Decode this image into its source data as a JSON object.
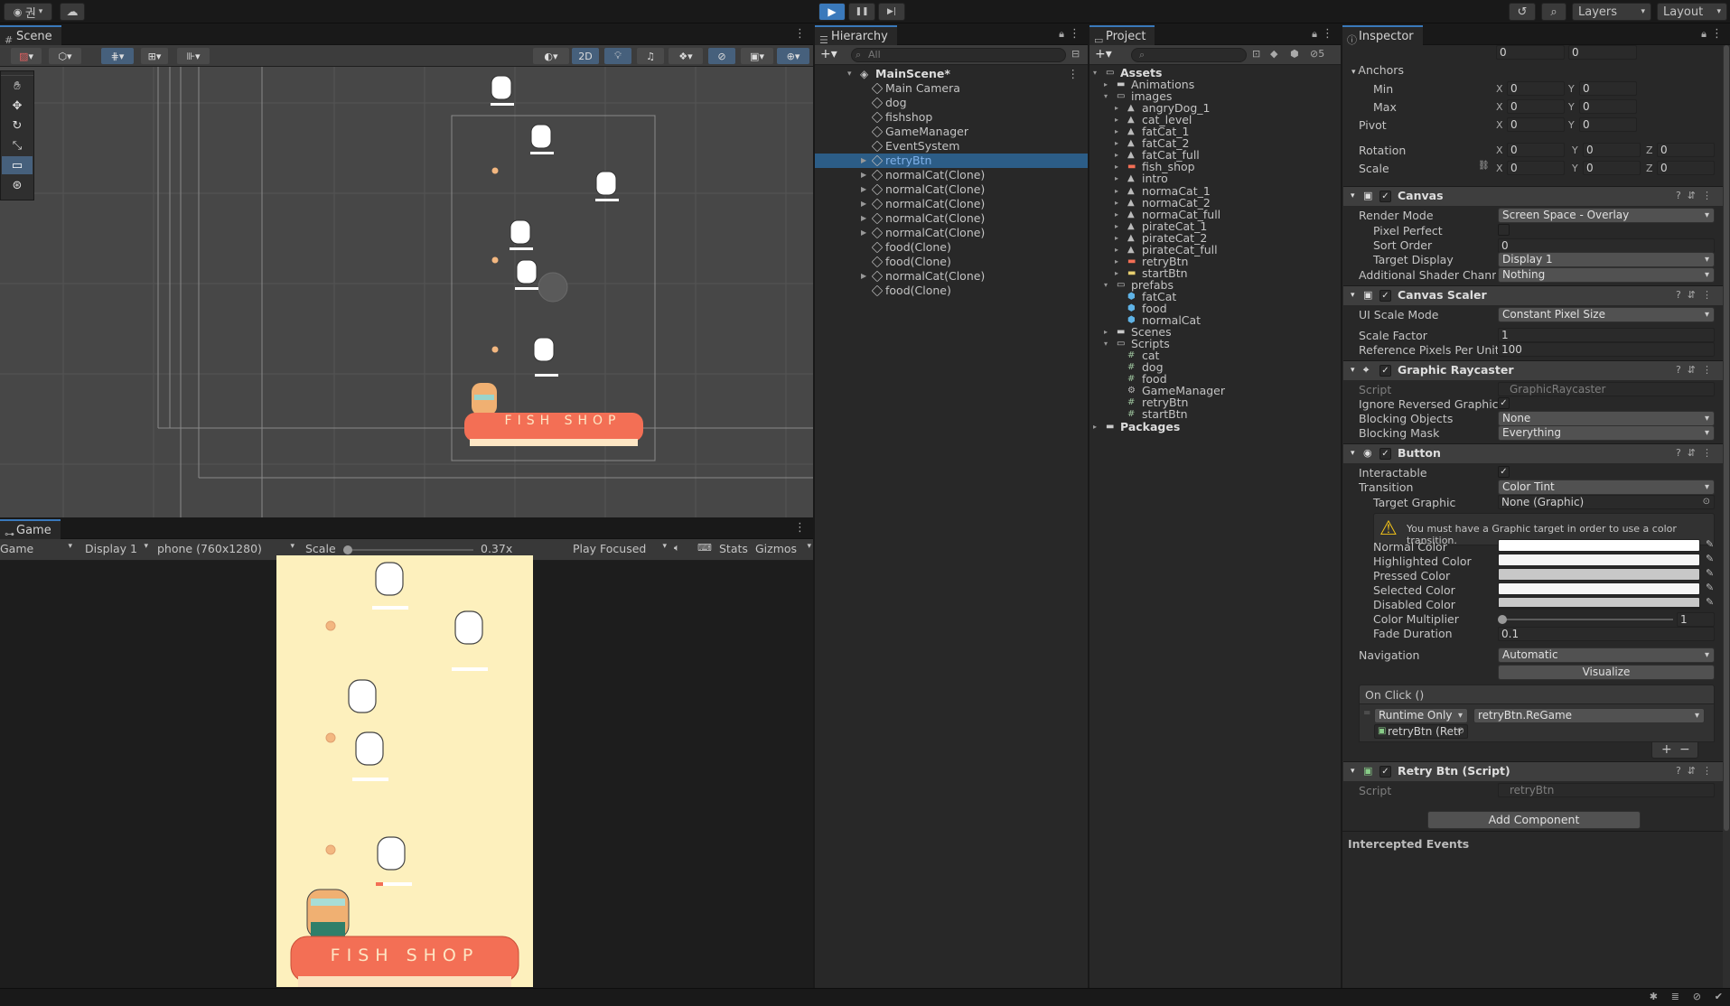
{
  "topbar": {
    "account": "권",
    "play": "▶",
    "pause": "❚❚",
    "step": "▶|",
    "layers": "Layers",
    "layout": "Layout"
  },
  "scene": {
    "tab": "Scene",
    "mode2d": "2D"
  },
  "game": {
    "tab": "Game",
    "view": "Game",
    "display": "Display 1",
    "resolution": "phone (760x1280)",
    "scale_label": "Scale",
    "scale_value": "0.37x",
    "play_mode": "Play Focused",
    "stats": "Stats",
    "gizmos": "Gizmos",
    "shop_text": "FISH  SHOP",
    "scene_shop_text": "FISH  SHOP"
  },
  "hierarchy": {
    "tab": "Hierarchy",
    "search_placeholder": "All",
    "scene": "MainScene*",
    "items": [
      {
        "label": "Main Camera",
        "arrow": false,
        "selected": false
      },
      {
        "label": "dog",
        "arrow": false,
        "selected": false
      },
      {
        "label": "fishshop",
        "arrow": false,
        "selected": false
      },
      {
        "label": "GameManager",
        "arrow": false,
        "selected": false
      },
      {
        "label": "EventSystem",
        "arrow": false,
        "selected": false
      },
      {
        "label": "retryBtn",
        "arrow": true,
        "selected": true
      },
      {
        "label": "normalCat(Clone)",
        "arrow": true,
        "selected": false
      },
      {
        "label": "normalCat(Clone)",
        "arrow": true,
        "selected": false
      },
      {
        "label": "normalCat(Clone)",
        "arrow": true,
        "selected": false
      },
      {
        "label": "normalCat(Clone)",
        "arrow": true,
        "selected": false
      },
      {
        "label": "normalCat(Clone)",
        "arrow": true,
        "selected": false
      },
      {
        "label": "food(Clone)",
        "arrow": false,
        "selected": false
      },
      {
        "label": "food(Clone)",
        "arrow": false,
        "selected": false
      },
      {
        "label": "normalCat(Clone)",
        "arrow": true,
        "selected": false
      },
      {
        "label": "food(Clone)",
        "arrow": false,
        "selected": false
      }
    ]
  },
  "project": {
    "tab": "Project",
    "hidden_count": "5",
    "tree": [
      {
        "label": "Assets",
        "indent": 0,
        "type": "folder-open",
        "arrow": "▾"
      },
      {
        "label": "Animations",
        "indent": 1,
        "type": "folder",
        "arrow": "▸"
      },
      {
        "label": "images",
        "indent": 1,
        "type": "folder-open",
        "arrow": "▾"
      },
      {
        "label": "angryDog_1",
        "indent": 2,
        "type": "sprite",
        "arrow": "▸"
      },
      {
        "label": "cat_level",
        "indent": 2,
        "type": "sprite",
        "arrow": "▸"
      },
      {
        "label": "fatCat_1",
        "indent": 2,
        "type": "sprite",
        "arrow": "▸"
      },
      {
        "label": "fatCat_2",
        "indent": 2,
        "type": "sprite",
        "arrow": "▸"
      },
      {
        "label": "fatCat_full",
        "indent": 2,
        "type": "sprite",
        "arrow": "▸"
      },
      {
        "label": "fish_shop",
        "indent": 2,
        "type": "sprite-red",
        "arrow": "▸"
      },
      {
        "label": "intro",
        "indent": 2,
        "type": "sprite",
        "arrow": "▸"
      },
      {
        "label": "normaCat_1",
        "indent": 2,
        "type": "sprite",
        "arrow": "▸"
      },
      {
        "label": "normaCat_2",
        "indent": 2,
        "type": "sprite",
        "arrow": "▸"
      },
      {
        "label": "normaCat_full",
        "indent": 2,
        "type": "sprite",
        "arrow": "▸"
      },
      {
        "label": "pirateCat_1",
        "indent": 2,
        "type": "sprite",
        "arrow": "▸"
      },
      {
        "label": "pirateCat_2",
        "indent": 2,
        "type": "sprite",
        "arrow": "▸"
      },
      {
        "label": "pirateCat_full",
        "indent": 2,
        "type": "sprite",
        "arrow": "▸"
      },
      {
        "label": "retryBtn",
        "indent": 2,
        "type": "sprite-red",
        "arrow": "▸"
      },
      {
        "label": "startBtn",
        "indent": 2,
        "type": "sprite-yellow",
        "arrow": "▸"
      },
      {
        "label": "prefabs",
        "indent": 1,
        "type": "folder-open",
        "arrow": "▾"
      },
      {
        "label": "fatCat",
        "indent": 2,
        "type": "prefab",
        "arrow": ""
      },
      {
        "label": "food",
        "indent": 2,
        "type": "prefab",
        "arrow": ""
      },
      {
        "label": "normalCat",
        "indent": 2,
        "type": "prefab",
        "arrow": ""
      },
      {
        "label": "Scenes",
        "indent": 1,
        "type": "folder",
        "arrow": "▸"
      },
      {
        "label": "Scripts",
        "indent": 1,
        "type": "folder-open",
        "arrow": "▾"
      },
      {
        "label": "cat",
        "indent": 2,
        "type": "script",
        "arrow": ""
      },
      {
        "label": "dog",
        "indent": 2,
        "type": "script",
        "arrow": ""
      },
      {
        "label": "food",
        "indent": 2,
        "type": "script",
        "arrow": ""
      },
      {
        "label": "GameManager",
        "indent": 2,
        "type": "gear",
        "arrow": ""
      },
      {
        "label": "retryBtn",
        "indent": 2,
        "type": "script",
        "arrow": ""
      },
      {
        "label": "startBtn",
        "indent": 2,
        "type": "script",
        "arrow": ""
      },
      {
        "label": "Packages",
        "indent": 0,
        "type": "folder",
        "arrow": "▸"
      }
    ]
  },
  "inspector": {
    "tab": "Inspector",
    "top_values": [
      "0",
      "0"
    ],
    "anchors": "Anchors",
    "min": "Min",
    "max": "Max",
    "pivot": "Pivot",
    "rotation": "Rotation",
    "scale": "Scale",
    "anchor_min": [
      "0",
      "0"
    ],
    "anchor_max": [
      "0",
      "0"
    ],
    "pivot_vals": [
      "0",
      "0"
    ],
    "rotation_vals": [
      "0",
      "0",
      "0"
    ],
    "scale_vals": [
      "0",
      "0",
      "0"
    ],
    "canvas": {
      "title": "Canvas",
      "render_mode_label": "Render Mode",
      "render_mode": "Screen Space - Overlay",
      "pixel_perfect": "Pixel Perfect",
      "sort_order_label": "Sort Order",
      "sort_order": "0",
      "target_display_label": "Target Display",
      "target_display": "Display 1",
      "shader_label": "Additional Shader Channels",
      "shader": "Nothing"
    },
    "scaler": {
      "title": "Canvas Scaler",
      "ui_scale_label": "UI Scale Mode",
      "ui_scale": "Constant Pixel Size",
      "scale_factor_label": "Scale Factor",
      "scale_factor": "1",
      "ref_ppu_label": "Reference Pixels Per Unit",
      "ref_ppu": "100"
    },
    "raycaster": {
      "title": "Graphic Raycaster",
      "script_label": "Script",
      "script": "GraphicRaycaster",
      "ignore_label": "Ignore Reversed Graphics",
      "blocking_objects_label": "Blocking Objects",
      "blocking_objects": "None",
      "blocking_mask_label": "Blocking Mask",
      "blocking_mask": "Everything"
    },
    "button": {
      "title": "Button",
      "interactable_label": "Interactable",
      "transition_label": "Transition",
      "transition": "Color Tint",
      "target_graphic_label": "Target Graphic",
      "target_graphic": "None (Graphic)",
      "warning": "You must have a Graphic target in order to use a color transition.",
      "normal": "Normal Color",
      "highlighted": "Highlighted Color",
      "pressed": "Pressed Color",
      "selected": "Selected Color",
      "disabled": "Disabled Color",
      "multiplier_label": "Color Multiplier",
      "multiplier": "1",
      "fade_label": "Fade Duration",
      "fade": "0.1",
      "navigation_label": "Navigation",
      "navigation": "Automatic",
      "visualize": "Visualize",
      "onclick": "On Click ()",
      "runtime": "Runtime Only",
      "method": "retryBtn.ReGame",
      "object": "retryBtn (Retr",
      "plus": "+",
      "minus": "−"
    },
    "retry_script": {
      "title": "Retry Btn (Script)",
      "script_label": "Script",
      "script": "retryBtn"
    },
    "add_component": "Add Component",
    "intercepted": "Intercepted Events"
  },
  "colors": {
    "accent": "#3a79bb",
    "selection": "#2c5d87",
    "game_bg": "#fdf0bd",
    "shop": "#f36f55",
    "food": "#f3b780"
  }
}
